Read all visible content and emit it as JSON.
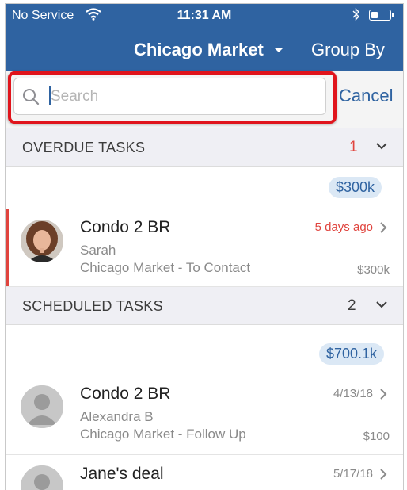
{
  "status_bar": {
    "carrier": "No Service",
    "time": "11:31 AM"
  },
  "nav": {
    "title": "Chicago Market",
    "group_by": "Group By"
  },
  "search": {
    "placeholder": "Search",
    "cancel": "Cancel"
  },
  "sections": [
    {
      "title": "OVERDUE TASKS",
      "count": "1",
      "count_color": "#e0443e",
      "total": "$300k",
      "tasks": [
        {
          "name": "Condo 2 BR",
          "person": "Sarah",
          "market": "Chicago Market - To Contact",
          "when": "5 days ago",
          "when_color": "#e0443e",
          "value": "$300k",
          "overdue": true
        }
      ]
    },
    {
      "title": "SCHEDULED TASKS",
      "count": "2",
      "count_color": "#3c3c3c",
      "total": "$700.1k",
      "tasks": [
        {
          "name": "Condo 2 BR",
          "person": "Alexandra B",
          "market": "Chicago Market - Follow Up",
          "when": "4/13/18",
          "when_color": "#8a8a8a",
          "value": "$100",
          "overdue": false
        },
        {
          "name": "Jane's deal",
          "when": "5/17/18",
          "when_color": "#8a8a8a",
          "overdue": false
        }
      ]
    }
  ],
  "colors": {
    "brand": "#2f63a1",
    "alert": "#e0443e",
    "highlight": "#e0141c"
  }
}
